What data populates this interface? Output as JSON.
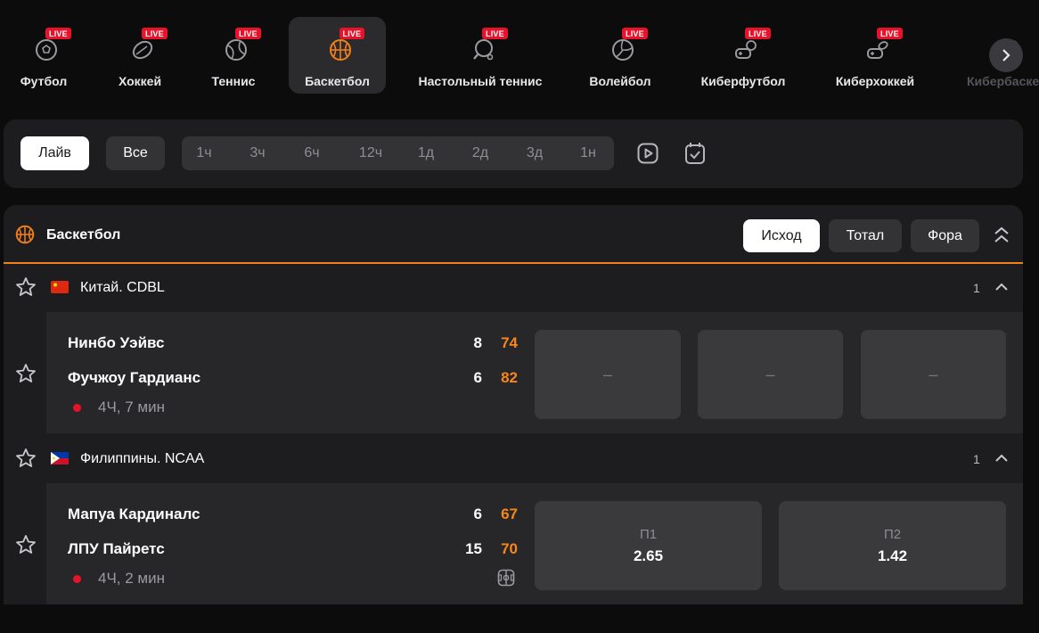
{
  "live_badge": "LIVE",
  "sports": [
    {
      "label": "Футбол",
      "icon": "football-icon"
    },
    {
      "label": "Хоккей",
      "icon": "hockey-puck-icon"
    },
    {
      "label": "Теннис",
      "icon": "tennis-ball-icon"
    },
    {
      "label": "Баскетбол",
      "icon": "basketball-icon"
    },
    {
      "label": "Настольный теннис",
      "icon": "table-tennis-icon"
    },
    {
      "label": "Волейбол",
      "icon": "volleyball-icon"
    },
    {
      "label": "Киберфутбол",
      "icon": "gamepad-ball-icon"
    },
    {
      "label": "Киберхоккей",
      "icon": "gamepad-puck-icon"
    },
    {
      "label": "Кибербаскетбол",
      "icon": "gamepad-basketball-icon"
    }
  ],
  "filters": {
    "live": "Лайв",
    "all": "Все",
    "periods": [
      "1ч",
      "3ч",
      "6ч",
      "12ч",
      "1д",
      "2д",
      "3д",
      "1н"
    ]
  },
  "section": {
    "title": "Баскетбол",
    "markets": [
      "Исход",
      "Тотал",
      "Фора"
    ]
  },
  "leagues": [
    {
      "name": "Китай. CDBL",
      "count": "1",
      "flag": "china",
      "match": {
        "team1": "Нинбо Уэйвс",
        "team1_period": "8",
        "team1_total": "74",
        "team2": "Фучжоу Гардианс",
        "team2_period": "6",
        "team2_total": "82",
        "status": "4Ч, 7 мин",
        "odds": [
          "–",
          "–",
          "–"
        ]
      }
    },
    {
      "name": "Филиппины. NCAA",
      "count": "1",
      "flag": "philippines",
      "match": {
        "team1": "Мапуа Кардиналс",
        "team1_period": "6",
        "team1_total": "67",
        "team2": "ЛПУ Пайретс",
        "team2_period": "15",
        "team2_total": "70",
        "status": "4Ч, 2 мин",
        "odds": [
          {
            "label": "П1",
            "value": "2.65"
          },
          {
            "label": "П2",
            "value": "1.42"
          }
        ]
      }
    }
  ],
  "colors": {
    "accent": "#f17f1b",
    "live": "#e8132a",
    "score": "#f7861d"
  }
}
